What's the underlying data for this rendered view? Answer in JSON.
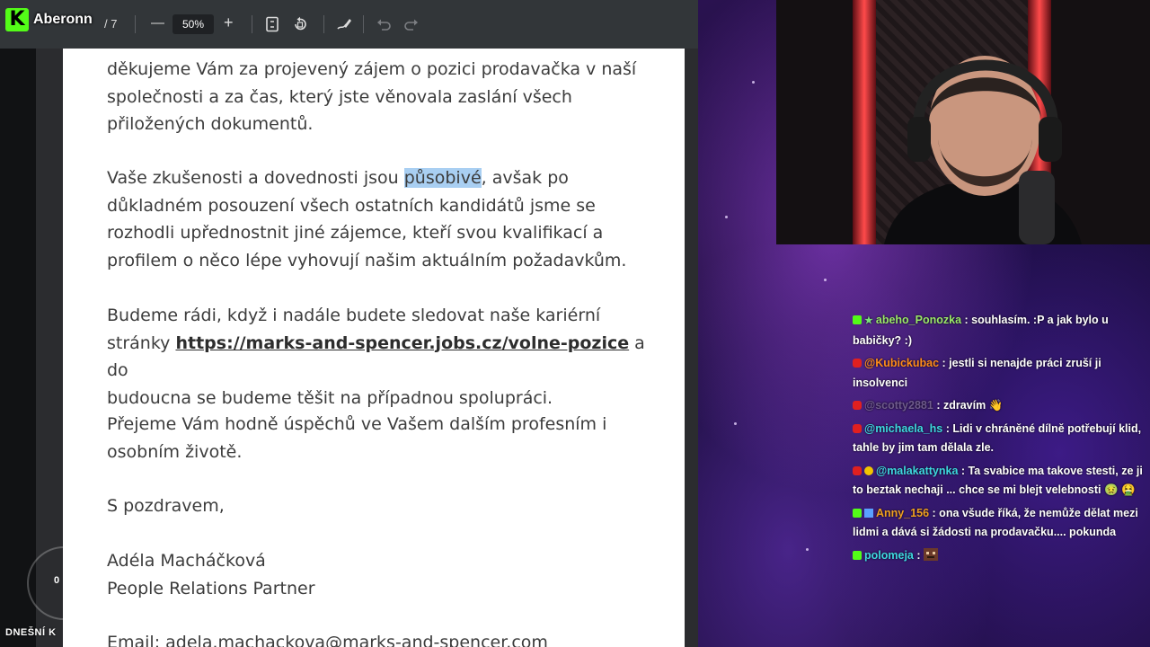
{
  "channel": {
    "name": "Aberonn",
    "logo_letter": "K"
  },
  "toolbar": {
    "page_indicator": "/ 7",
    "zoom_out": "—",
    "zoom_level": "50%",
    "zoom_in": "+"
  },
  "document": {
    "paragraphs": [
      {
        "text": "děkujeme Vám za projevený zájem o pozici prodavačka v naší\nspolečnosti a za čas, který jste věnovala zaslání všech\npřiložených dokumentů."
      },
      {
        "before": "Vaše zkušenosti a dovednosti jsou ",
        "highlight": "působivé",
        "after": ", avšak po\ndůkladném posouzení všech ostatních kandidátů jsme se\nrozhodli upřednostnit jiné zájemce, kteří svou kvalifikací a\nprofilem o něco lépe vyhovují našim aktuálním požadavkům."
      },
      {
        "before": "Budeme rádi, když i nadále budete sledovat naše kariérní\nstránky ",
        "link": "https://marks-and-spencer.jobs.cz/volne-pozice",
        "after": " a do\nbudoucna se budeme těšit na případnou spolupráci."
      },
      {
        "text": "Přejeme Vám hodně úspěchů ve Vašem dalším profesním i\nosobním životě."
      },
      {
        "text": "S pozdravem,"
      },
      {
        "text": "Adéla Macháčková\nPeople Relations Partner"
      },
      {
        "text": "Email: adela.machackova@marks-and-spencer.com"
      }
    ]
  },
  "overlay": {
    "circle_value": "0",
    "bottom_label": "DNEŠNÍ K"
  },
  "chat": {
    "messages": [
      {
        "user": "abeho_Ponozka",
        "color": "#9be86a",
        "platform": "kick",
        "text": ": souhlasím. :P a jak bylo u babičky? :)"
      },
      {
        "user": "@Kubickubac",
        "color": "#ff8c1a",
        "platform": "youtube",
        "text": ": jestli si nenajde práci zruší ji insolvenci"
      },
      {
        "user": "@scotty2881",
        "color": "#6e5a8c",
        "platform": "youtube",
        "text": ": zdravím 👋"
      },
      {
        "user": "@michaela_hs",
        "color": "#3ed8e0",
        "platform": "youtube",
        "text": ": Lidi v chráněné dílně potřebují klid, tahle by jim tam dělala zle."
      },
      {
        "user": "@malakattynka",
        "color": "#3ed8e0",
        "platform": "youtube",
        "text": ": Ta svabice ma takove stesti, ze ji to beztak nechaji ... chce se mi blejt velebnosti 🤢 🤮"
      },
      {
        "user": "Anny_156",
        "color": "#f0a020",
        "platform": "kick",
        "text": ": ona všude říká, že nemůže dělat mezi lidmi a dává si žádosti na prodavačku.... pokunda"
      },
      {
        "user": "polomeja",
        "color": "#3ed8e0",
        "platform": "kick",
        "text": ":"
      }
    ]
  },
  "colors": {
    "kick_green": "#53fc18",
    "highlight": "#a9cff2",
    "toolbar": "#323639"
  }
}
